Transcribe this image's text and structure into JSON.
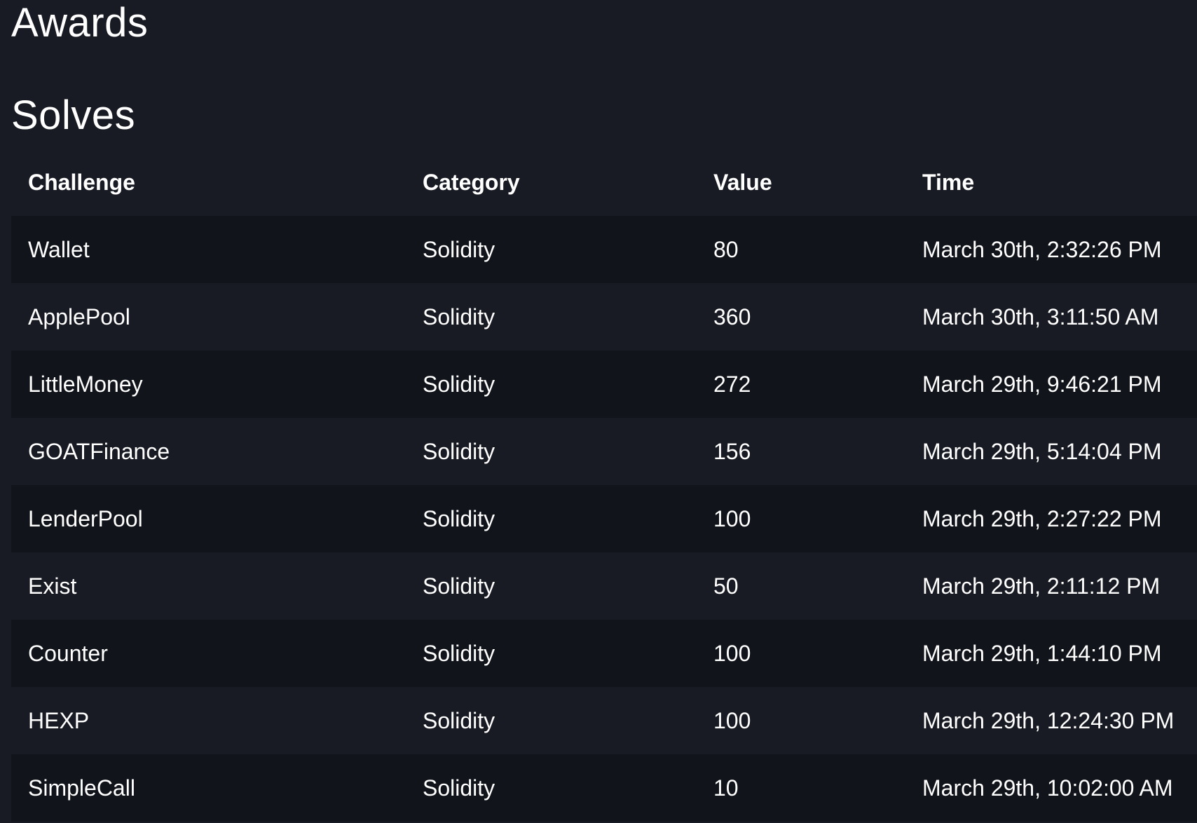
{
  "page": {
    "awards_title": "Awards",
    "solves_title": "Solves"
  },
  "table": {
    "headers": {
      "challenge": "Challenge",
      "category": "Category",
      "value": "Value",
      "time": "Time"
    },
    "rows": [
      {
        "challenge": "Wallet",
        "category": "Solidity",
        "value": "80",
        "time": "March 30th, 2:32:26 PM"
      },
      {
        "challenge": "ApplePool",
        "category": "Solidity",
        "value": "360",
        "time": "March 30th, 3:11:50 AM"
      },
      {
        "challenge": "LittleMoney",
        "category": "Solidity",
        "value": "272",
        "time": "March 29th, 9:46:21 PM"
      },
      {
        "challenge": "GOATFinance",
        "category": "Solidity",
        "value": "156",
        "time": "March 29th, 5:14:04 PM"
      },
      {
        "challenge": "LenderPool",
        "category": "Solidity",
        "value": "100",
        "time": "March 29th, 2:27:22 PM"
      },
      {
        "challenge": "Exist",
        "category": "Solidity",
        "value": "50",
        "time": "March 29th, 2:11:12 PM"
      },
      {
        "challenge": "Counter",
        "category": "Solidity",
        "value": "100",
        "time": "March 29th, 1:44:10 PM"
      },
      {
        "challenge": "HEXP",
        "category": "Solidity",
        "value": "100",
        "time": "March 29th, 12:24:30 PM"
      },
      {
        "challenge": "SimpleCall",
        "category": "Solidity",
        "value": "10",
        "time": "March 29th, 10:02:00 AM"
      }
    ]
  },
  "colors": {
    "background": "#181b23",
    "row_alt": "#11141b",
    "text": "#ffffff"
  }
}
